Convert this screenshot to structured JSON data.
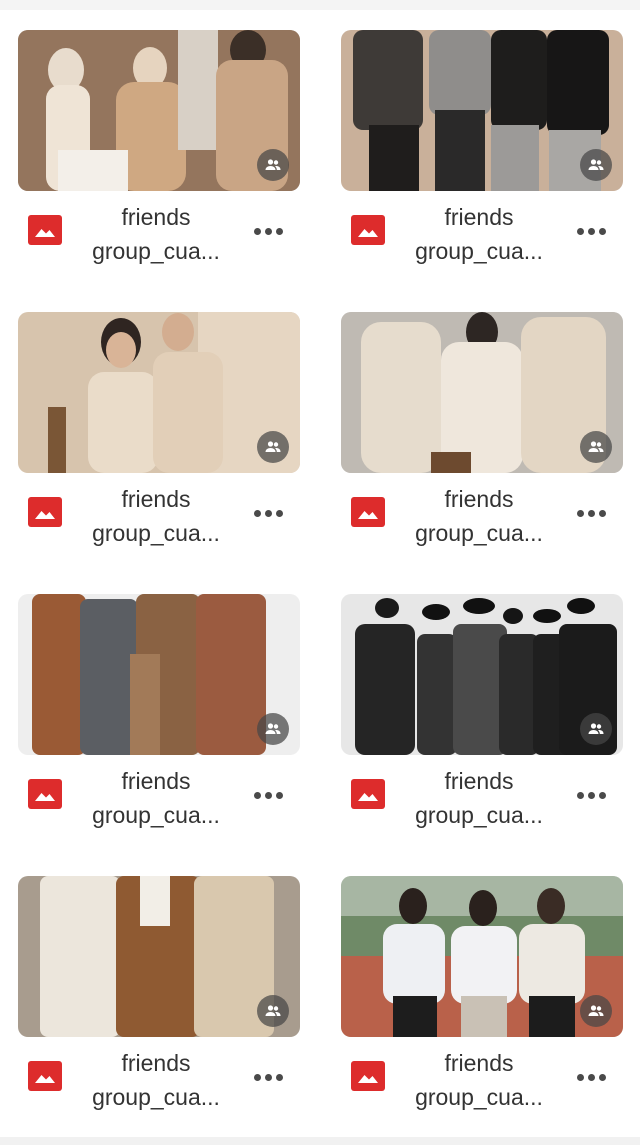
{
  "colors": {
    "file_icon": "#dd2c2c",
    "text": "#333333",
    "badge": "#464646"
  },
  "icons": {
    "file_type": "image-file-icon",
    "shared": "people-icon",
    "menu": "more-horizontal-icon"
  },
  "files": [
    {
      "name_line1": "friends",
      "name_line2": "group_cua..."
    },
    {
      "name_line1": "friends",
      "name_line2": "group_cua..."
    },
    {
      "name_line1": "friends",
      "name_line2": "group_cua..."
    },
    {
      "name_line1": "friends",
      "name_line2": "group_cua..."
    },
    {
      "name_line1": "friends",
      "name_line2": "group_cua..."
    },
    {
      "name_line1": "friends",
      "name_line2": "group_cua..."
    },
    {
      "name_line1": "friends",
      "name_line2": "group_cua..."
    },
    {
      "name_line1": "friends",
      "name_line2": "group_cua..."
    }
  ]
}
